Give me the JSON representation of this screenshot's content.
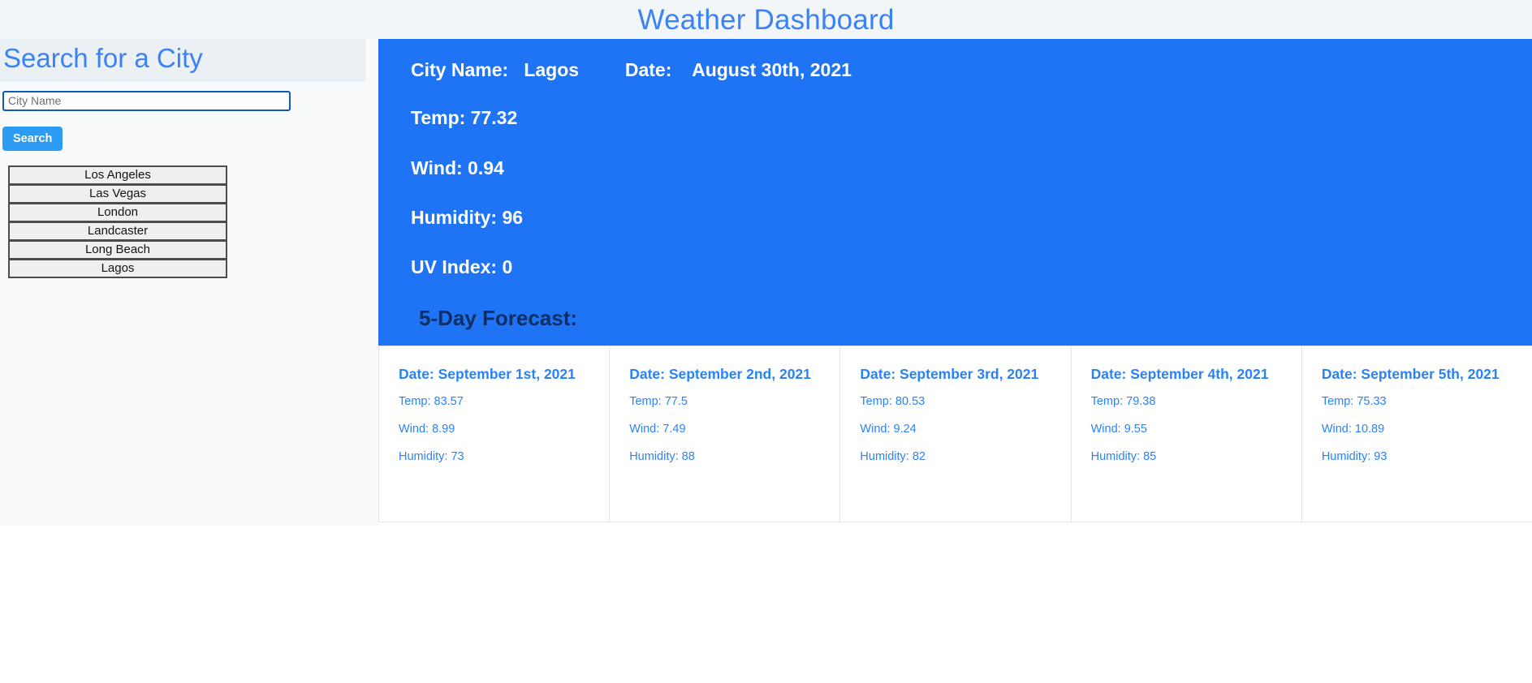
{
  "header": {
    "title": "Weather Dashboard"
  },
  "sidebar": {
    "heading": "Search for a City",
    "search_input": {
      "placeholder": "City Name",
      "value": ""
    },
    "search_button_label": "Search",
    "cities": [
      {
        "label": "Los Angeles"
      },
      {
        "label": "Las Vegas"
      },
      {
        "label": "London"
      },
      {
        "label": "Landcaster"
      },
      {
        "label": "Long Beach"
      },
      {
        "label": "Lagos"
      }
    ]
  },
  "current_weather": {
    "city_label": "City Name:",
    "city_value": "Lagos",
    "date_label": "Date:",
    "date_value": "August 30th, 2021",
    "temp": "Temp: 77.32",
    "wind": "Wind: 0.94",
    "humidity": "Humidity: 96",
    "uv_index": "UV Index: 0",
    "forecast_heading": "5-Day Forecast:"
  },
  "forecast": [
    {
      "date": "Date: September 1st, 2021",
      "temp": "Temp: 83.57",
      "wind": "Wind: 8.99",
      "humidity": "Humidity: 73"
    },
    {
      "date": "Date: September 2nd, 2021",
      "temp": "Temp: 77.5",
      "wind": "Wind: 7.49",
      "humidity": "Humidity: 88"
    },
    {
      "date": "Date: September 3rd, 2021",
      "temp": "Temp: 80.53",
      "wind": "Wind: 9.24",
      "humidity": "Humidity: 82"
    },
    {
      "date": "Date: September 4th, 2021",
      "temp": "Temp: 79.38",
      "wind": "Wind: 9.55",
      "humidity": "Humidity: 85"
    },
    {
      "date": "Date: September 5th, 2021",
      "temp": "Temp: 75.33",
      "wind": "Wind: 10.89",
      "humidity": "Humidity: 93"
    }
  ],
  "colors": {
    "accent_blue": "#3b82f6",
    "panel_blue": "#1f74f5",
    "button_blue": "#2b9bf4",
    "heading_band": "#eaf0f4",
    "sidebar_bg": "#f8fafb",
    "forecast_heading": "#0d2f63"
  }
}
